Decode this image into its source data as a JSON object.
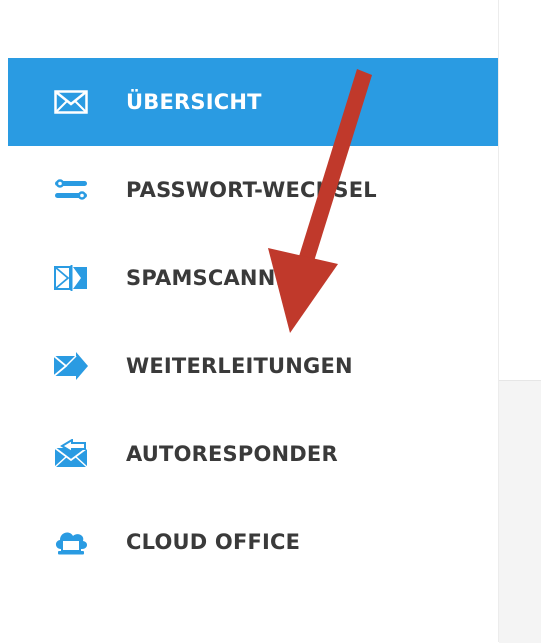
{
  "menu": {
    "items": [
      {
        "label": "ÜBERSICHT",
        "icon": "envelope-icon",
        "active": true
      },
      {
        "label": "PASSWORT-WECHSEL",
        "icon": "settings-sliders-icon",
        "active": false
      },
      {
        "label": "SPAMSCANNER",
        "icon": "spam-scanner-icon",
        "active": false
      },
      {
        "label": "WEITERLEITUNGEN",
        "icon": "forward-mail-icon",
        "active": false
      },
      {
        "label": "AUTORESPONDER",
        "icon": "autoresponder-icon",
        "active": false
      },
      {
        "label": "CLOUD OFFICE",
        "icon": "cloud-office-icon",
        "active": false
      }
    ]
  },
  "colors": {
    "active_bg": "#2a9be2",
    "icon_blue": "#2a9be2",
    "label_text": "#3a3a3a",
    "annotation_arrow": "#c0392b"
  }
}
